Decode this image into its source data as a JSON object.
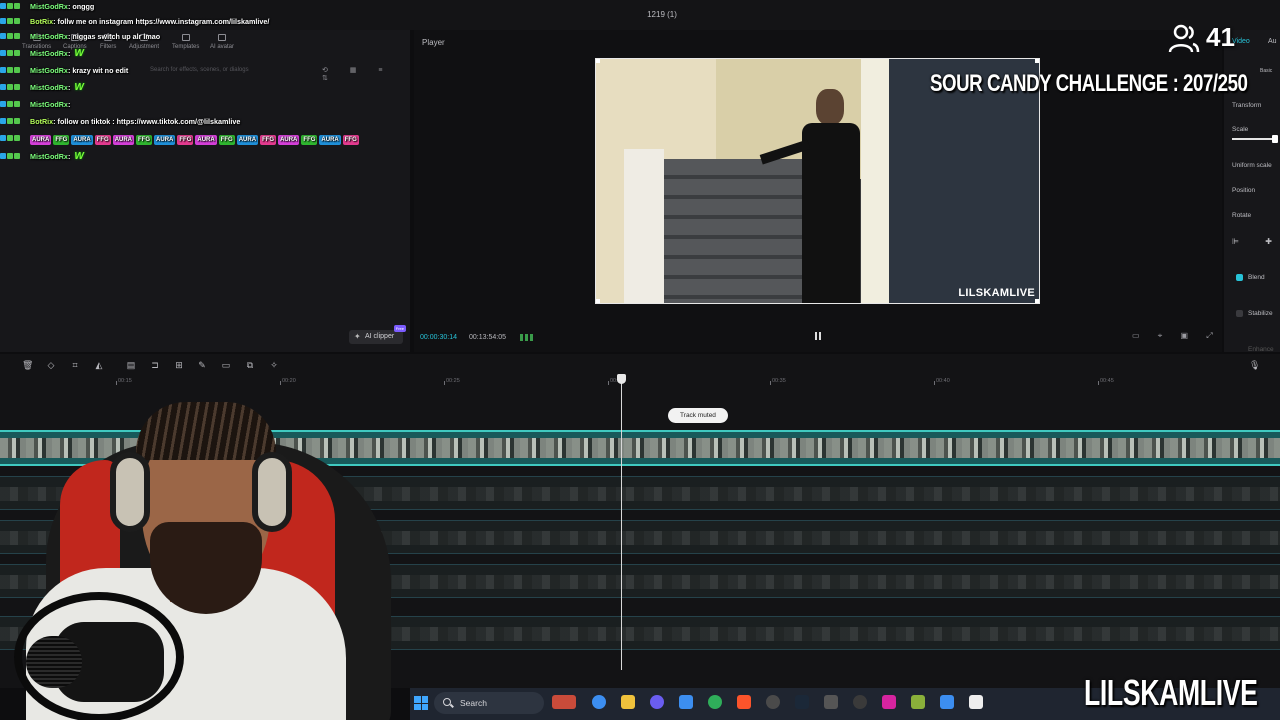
{
  "window": {
    "project_title": "1219 (1)"
  },
  "media_panel": {
    "tabs": [
      "Transitions",
      "Captions",
      "Filters",
      "Adjustment",
      "Templates",
      "AI avatar"
    ],
    "search_placeholder": "Search for effects, scenes, or dialogs",
    "ai_clipper_label": "AI clipper",
    "ai_clipper_badge": "Free"
  },
  "chat": [
    {
      "user": "MistGodRx",
      "message": ": onggg",
      "bot": false
    },
    {
      "user": "BotRix",
      "message": ": follw me on instagram https://www.instagram.com/lilskamlive/",
      "bot": true
    },
    {
      "user": "MistGodRx",
      "message": ": niggas switch up alr lmao",
      "bot": false
    },
    {
      "user": "MistGodRx",
      "message": ":",
      "emote": "W",
      "bot": false
    },
    {
      "user": "MistGodRx",
      "message": ": krazy wit no edit",
      "bot": false
    },
    {
      "user": "MistGodRx",
      "message": ":",
      "emote": "W",
      "bot": false
    },
    {
      "user": "MistGodRx",
      "message": ":",
      "bot": false
    },
    {
      "user": "BotRix",
      "message": ": follow on tiktok : https://www.tiktok.com/@lilskamlive",
      "bot": true
    },
    {
      "user": "",
      "message": "",
      "emotes": [
        "AURA",
        "FFG",
        "AURA",
        "FFG",
        "AURA",
        "FFG",
        "AURA",
        "FFG",
        "AURA",
        "FFG",
        "AURA",
        "FFG",
        "AURA",
        "FFG",
        "AURA",
        "FFG"
      ],
      "bot": false
    },
    {
      "user": "MistGodRx",
      "message": ":",
      "emote": "W",
      "bot": false
    }
  ],
  "player": {
    "title": "Player",
    "watermark": "LILSKAMLIVE",
    "current_time": "00:00:30:14",
    "total_time": "00:13:54:05",
    "right_tools": [
      "Full",
      "Ratio"
    ]
  },
  "inspector": {
    "tabs": [
      "Video",
      "Au"
    ],
    "basic_label": "Basic",
    "transform_label": "Transform",
    "scale_label": "Scale",
    "uniform_scale_label": "Uniform scale",
    "position_label": "Position",
    "rotate_label": "Rotate",
    "blend_label": "Blend",
    "stabilize_label": "Stabilize",
    "enhance_label": "Enhance"
  },
  "overlay": {
    "viewer_count": "41",
    "challenge_text": "SOUR CANDY CHALLENGE : 207/250",
    "brand_text": "LILSKAMLIVE"
  },
  "timeline": {
    "ruler_ticks": [
      "00:15",
      "00:20",
      "00:25",
      "00:30",
      "00:35",
      "00:40",
      "00:45"
    ],
    "track_muted_label": "Track muted"
  },
  "taskbar": {
    "search_label": "Search",
    "colors": {
      "accent": "#27c3d8",
      "track": "#18595a",
      "chat_user": "#7dff7d"
    }
  }
}
